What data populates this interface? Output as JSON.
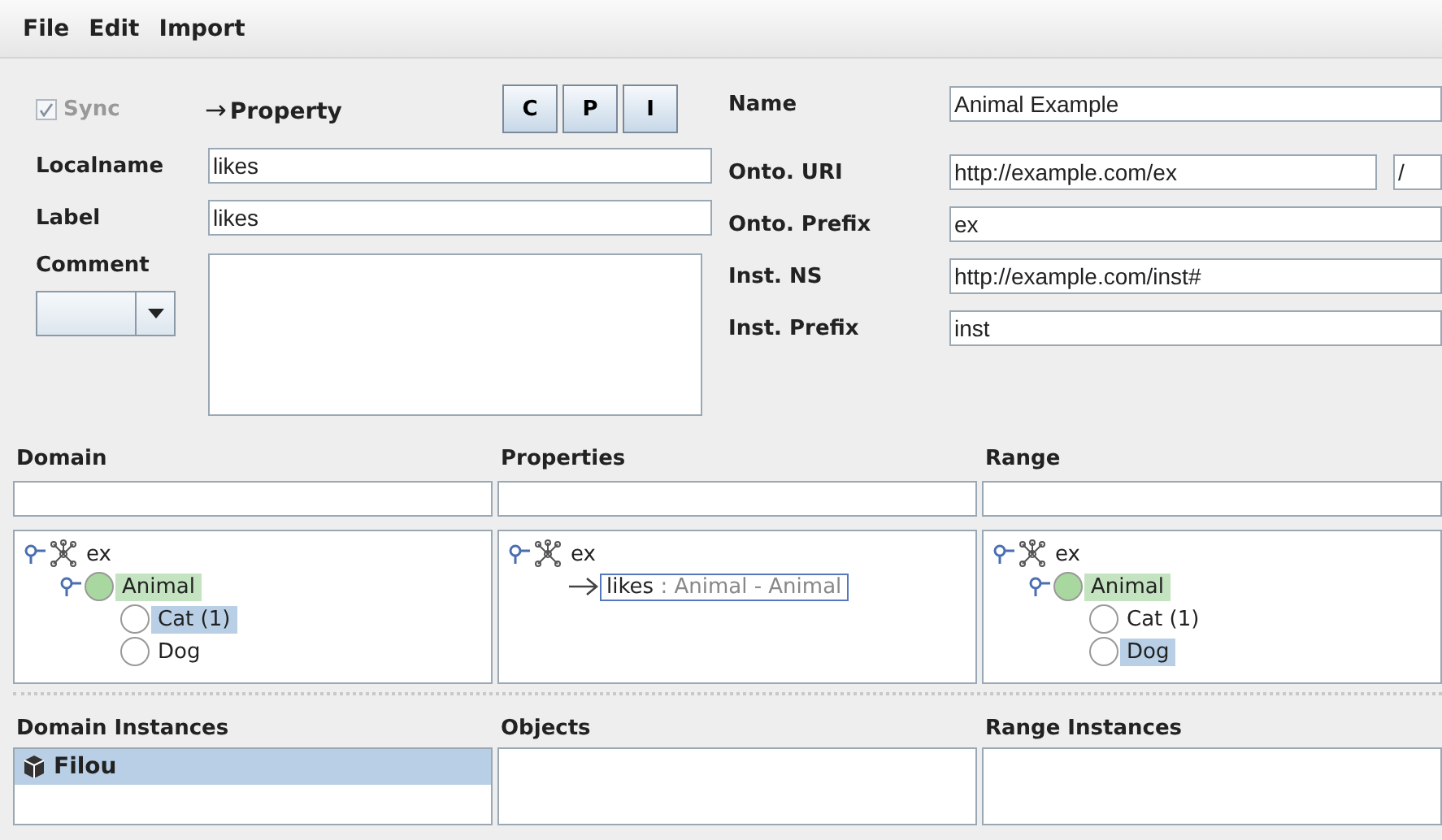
{
  "menu": [
    "File",
    "Edit",
    "Import"
  ],
  "sync": {
    "label": "Sync",
    "checked": true,
    "disabled": true
  },
  "entity_type": {
    "arrow": "→",
    "label": "Property"
  },
  "type_buttons": [
    "C",
    "P",
    "I"
  ],
  "left_fields": [
    {
      "label": "Localname",
      "value": "likes"
    },
    {
      "label": "Label",
      "value": "likes"
    }
  ],
  "comment": {
    "label": "Comment"
  },
  "right_fields": [
    {
      "label": "Name",
      "value": "Animal Example"
    },
    {
      "label": "Onto. URI",
      "value": "http://example.com/ex",
      "suffix": "/"
    },
    {
      "label": "Onto. Prefix",
      "value": "ex"
    },
    {
      "label": "Inst. NS",
      "value": "http://example.com/inst#"
    },
    {
      "label": "Inst. Prefix",
      "value": "inst"
    }
  ],
  "tree_panels": [
    {
      "title": "Domain",
      "tree": [
        {
          "kind": "ontology",
          "label": "ex",
          "expanded": true,
          "selected": false,
          "highlighted": false,
          "children": [
            {
              "kind": "class",
              "label": "Animal",
              "expanded": true,
              "selected": false,
              "highlighted": true,
              "children": [
                {
                  "kind": "class",
                  "label": "Cat (1)",
                  "selected": true,
                  "highlighted": false
                },
                {
                  "kind": "class",
                  "label": "Dog",
                  "selected": false,
                  "highlighted": false
                }
              ]
            }
          ]
        }
      ]
    },
    {
      "title": "Properties",
      "tree": [
        {
          "kind": "ontology",
          "label": "ex",
          "expanded": true,
          "selected": false,
          "highlighted": false,
          "children": [
            {
              "kind": "property",
              "label": "likes",
              "detail": ": Animal - Animal",
              "selected": true,
              "highlighted": false
            }
          ]
        }
      ]
    },
    {
      "title": "Range",
      "tree": [
        {
          "kind": "ontology",
          "label": "ex",
          "expanded": true,
          "selected": false,
          "highlighted": false,
          "children": [
            {
              "kind": "class",
              "label": "Animal",
              "expanded": true,
              "selected": false,
              "highlighted": true,
              "children": [
                {
                  "kind": "class",
                  "label": "Cat (1)",
                  "selected": false,
                  "highlighted": false
                },
                {
                  "kind": "class",
                  "label": "Dog",
                  "selected": true,
                  "highlighted": false
                }
              ]
            }
          ]
        }
      ]
    }
  ],
  "instance_panels": [
    {
      "title": "Domain Instances",
      "items": [
        {
          "label": "Filou",
          "selected": true
        }
      ]
    },
    {
      "title": "Objects"
    },
    {
      "title": "Range Instances"
    }
  ]
}
